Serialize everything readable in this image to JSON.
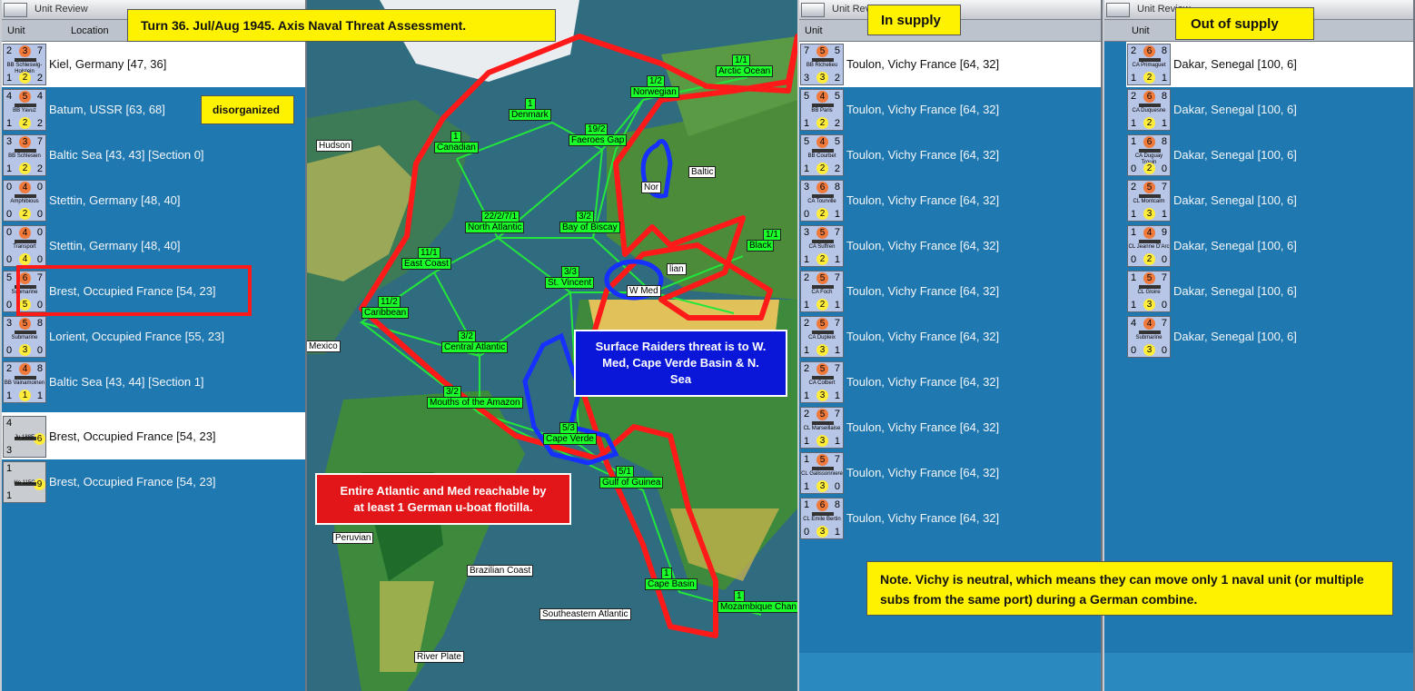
{
  "left_panel": {
    "title": "Unit Review",
    "col_unit": "Unit",
    "col_location": "Location",
    "rows": [
      {
        "tl": "2",
        "tr": "7",
        "c1": "3",
        "bl": "1",
        "c2": "2",
        "br": "2",
        "name": "BB Schleswig-Holstein",
        "loc": "Kiel, Germany [47, 36]",
        "sel": true
      },
      {
        "tl": "4",
        "tr": "4",
        "c1": "5",
        "bl": "1",
        "c2": "2",
        "br": "2",
        "name": "BB Yavuz",
        "loc": "Batum, USSR [63, 68]"
      },
      {
        "tl": "3",
        "tr": "7",
        "c1": "3",
        "bl": "1",
        "c2": "2",
        "br": "2",
        "name": "BB Schlesien",
        "loc": "Baltic Sea [43, 43] [Section 0]"
      },
      {
        "tl": "0",
        "tr": "0",
        "c1": "4",
        "bl": "0",
        "c2": "2",
        "br": "0",
        "name": "Amphibious",
        "loc": "Stettin, Germany [48, 40]"
      },
      {
        "tl": "0",
        "tr": "0",
        "c1": "4",
        "bl": "0",
        "c2": "4",
        "br": "0",
        "name": "Transport",
        "loc": "Stettin, Germany [48, 40]"
      },
      {
        "tl": "5",
        "tr": "7",
        "c1": "6",
        "bl": "0",
        "c2": "5",
        "br": "0",
        "name": "Submarine",
        "loc": "Brest, Occupied France [54, 23]"
      },
      {
        "tl": "3",
        "tr": "8",
        "c1": "5",
        "bl": "0",
        "c2": "3",
        "br": "0",
        "name": "Submarine",
        "loc": "Lorient, Occupied France [55, 23]"
      },
      {
        "tl": "2",
        "tr": "8",
        "c1": "4",
        "bl": "1",
        "c2": "1",
        "br": "1",
        "name": "BB Vainamoinen",
        "loc": "Baltic Sea [43, 44] [Section 1]"
      }
    ],
    "air_rows": [
      {
        "tl": "4",
        "c1": "6",
        "bl": "3",
        "name": "Ju 188E",
        "loc": "Brest, Occupied France [54, 23]",
        "sel": true
      },
      {
        "tl": "1",
        "c1": "9",
        "bl": "1",
        "top": "2",
        "name": "He 115C",
        "loc": "Brest, Occupied France [54, 23]"
      }
    ]
  },
  "mid_panel": {
    "title": "Unit Review",
    "col_unit": "Unit",
    "rows": [
      {
        "tl": "7",
        "tr": "5",
        "c1": "5",
        "bl": "3",
        "c2": "3",
        "br": "2",
        "name": "BB Richelieu",
        "loc": "Toulon, Vichy France [64, 32]",
        "sel": true
      },
      {
        "tl": "5",
        "tr": "5",
        "c1": "4",
        "bl": "1",
        "c2": "2",
        "br": "2",
        "name": "BB Paris",
        "loc": "Toulon, Vichy France [64, 32]"
      },
      {
        "tl": "5",
        "tr": "5",
        "c1": "4",
        "bl": "1",
        "c2": "2",
        "br": "2",
        "name": "BB Courbet",
        "loc": "Toulon, Vichy France [64, 32]"
      },
      {
        "tl": "3",
        "tr": "8",
        "c1": "6",
        "bl": "0",
        "c2": "2",
        "br": "1",
        "name": "CA Tourville",
        "loc": "Toulon, Vichy France [64, 32]"
      },
      {
        "tl": "3",
        "tr": "7",
        "c1": "5",
        "bl": "1",
        "c2": "2",
        "br": "1",
        "name": "CA Suffren",
        "loc": "Toulon, Vichy France [64, 32]"
      },
      {
        "tl": "2",
        "tr": "7",
        "c1": "5",
        "bl": "1",
        "c2": "2",
        "br": "1",
        "name": "CA Foch",
        "loc": "Toulon, Vichy France [64, 32]"
      },
      {
        "tl": "2",
        "tr": "7",
        "c1": "5",
        "bl": "1",
        "c2": "3",
        "br": "1",
        "name": "CA Dupleix",
        "loc": "Toulon, Vichy France [64, 32]"
      },
      {
        "tl": "2",
        "tr": "7",
        "c1": "5",
        "bl": "1",
        "c2": "3",
        "br": "1",
        "name": "CA Colbert",
        "loc": "Toulon, Vichy France [64, 32]"
      },
      {
        "tl": "2",
        "tr": "7",
        "c1": "5",
        "bl": "1",
        "c2": "3",
        "br": "1",
        "name": "CL Marseillaise",
        "loc": "Toulon, Vichy France [64, 32]"
      },
      {
        "tl": "1",
        "tr": "7",
        "c1": "5",
        "bl": "1",
        "c2": "3",
        "br": "0",
        "name": "CL Galissonniere",
        "loc": "Toulon, Vichy France [64, 32]"
      },
      {
        "tl": "1",
        "tr": "8",
        "c1": "6",
        "bl": "0",
        "c2": "3",
        "br": "1",
        "name": "CL Emile Bertin",
        "loc": "Toulon, Vichy France [64, 32]"
      }
    ]
  },
  "right_panel": {
    "title": "Unit Review",
    "col_unit": "Unit",
    "rows": [
      {
        "tl": "2",
        "tr": "8",
        "c1": "6",
        "bl": "1",
        "c2": "2",
        "br": "1",
        "name": "CA Primaguet",
        "loc": "Dakar, Senegal [100, 6]",
        "sel": true
      },
      {
        "tl": "2",
        "tr": "8",
        "c1": "6",
        "bl": "1",
        "c2": "2",
        "br": "1",
        "name": "CA Duquesne",
        "loc": "Dakar, Senegal [100, 6]"
      },
      {
        "tl": "1",
        "tr": "8",
        "c1": "6",
        "bl": "0",
        "c2": "2",
        "br": "0",
        "name": "CA Duguay Trouin",
        "loc": "Dakar, Senegal [100, 6]"
      },
      {
        "tl": "2",
        "tr": "7",
        "c1": "5",
        "bl": "1",
        "c2": "3",
        "br": "1",
        "name": "CL Montcalm",
        "loc": "Dakar, Senegal [100, 6]"
      },
      {
        "tl": "1",
        "tr": "9",
        "c1": "4",
        "bl": "0",
        "c2": "2",
        "br": "0",
        "name": "CL Jeanne D'Arc",
        "loc": "Dakar, Senegal [100, 6]"
      },
      {
        "tl": "1",
        "tr": "7",
        "c1": "5",
        "bl": "1",
        "c2": "3",
        "br": "0",
        "name": "CL Gloire",
        "loc": "Dakar, Senegal [100, 6]"
      },
      {
        "tl": "4",
        "tr": "7",
        "c1": "4",
        "bl": "0",
        "c2": "3",
        "br": "0",
        "name": "Submarine",
        "loc": "Dakar, Senegal [100, 6]"
      }
    ]
  },
  "annotations": {
    "turn": "Turn 36.  Jul/Aug 1945.  Axis Naval Threat Assessment.",
    "disorganized": "disorganized",
    "in_supply": "In supply",
    "out_supply": "Out of  supply",
    "surface_raiders": "Surface Raiders threat is to W. Med, Cape Verde Basin & N. Sea",
    "uboat": "Entire Atlantic and Med reachable by at least 1 German u-boat flotilla.",
    "note": "Note.  Vichy is neutral, which means they can move only 1 naval unit (or multiple subs from the same port) during a German combine."
  },
  "map_labels": [
    {
      "t": "Arctic Ocean",
      "v": "1/1"
    },
    {
      "t": "Norwegian",
      "v": "1/2"
    },
    {
      "t": "Denmark",
      "v": "1"
    },
    {
      "t": "Faeroes Gap",
      "v": "19/2"
    },
    {
      "t": "Canadian",
      "v": "1"
    },
    {
      "t": "North Atlantic",
      "v": "22/2/7/1"
    },
    {
      "t": "Bay of Biscay",
      "v": "3/2"
    },
    {
      "t": "East Coast",
      "v": "11/1"
    },
    {
      "t": "St. Vincent",
      "v": "3/3"
    },
    {
      "t": "Caribbean",
      "v": "11/2"
    },
    {
      "t": "Central Atlantic",
      "v": "3/2"
    },
    {
      "t": "Mouths of the Amazon",
      "v": "3/2"
    },
    {
      "t": "Cape Verde",
      "v": "5/3"
    },
    {
      "t": "Gulf of Guinea",
      "v": "5/1"
    },
    {
      "t": "Cape Basin",
      "v": "1"
    },
    {
      "t": "Mozambique Chan",
      "v": "1"
    },
    {
      "t": "W Med",
      "v": ""
    },
    {
      "t": "Black",
      "v": "1/1"
    },
    {
      "t": "Baltic",
      "v": ""
    },
    {
      "t": "Hudson",
      "v": ""
    },
    {
      "t": "Mexico",
      "v": ""
    },
    {
      "t": "Peruvian",
      "v": ""
    },
    {
      "t": "Brazilian Coast",
      "v": ""
    },
    {
      "t": "Southeastern Atlantic",
      "v": ""
    },
    {
      "t": "River Plate",
      "v": ""
    },
    {
      "t": "Nor",
      "v": ""
    },
    {
      "t": "lian",
      "v": ""
    }
  ]
}
